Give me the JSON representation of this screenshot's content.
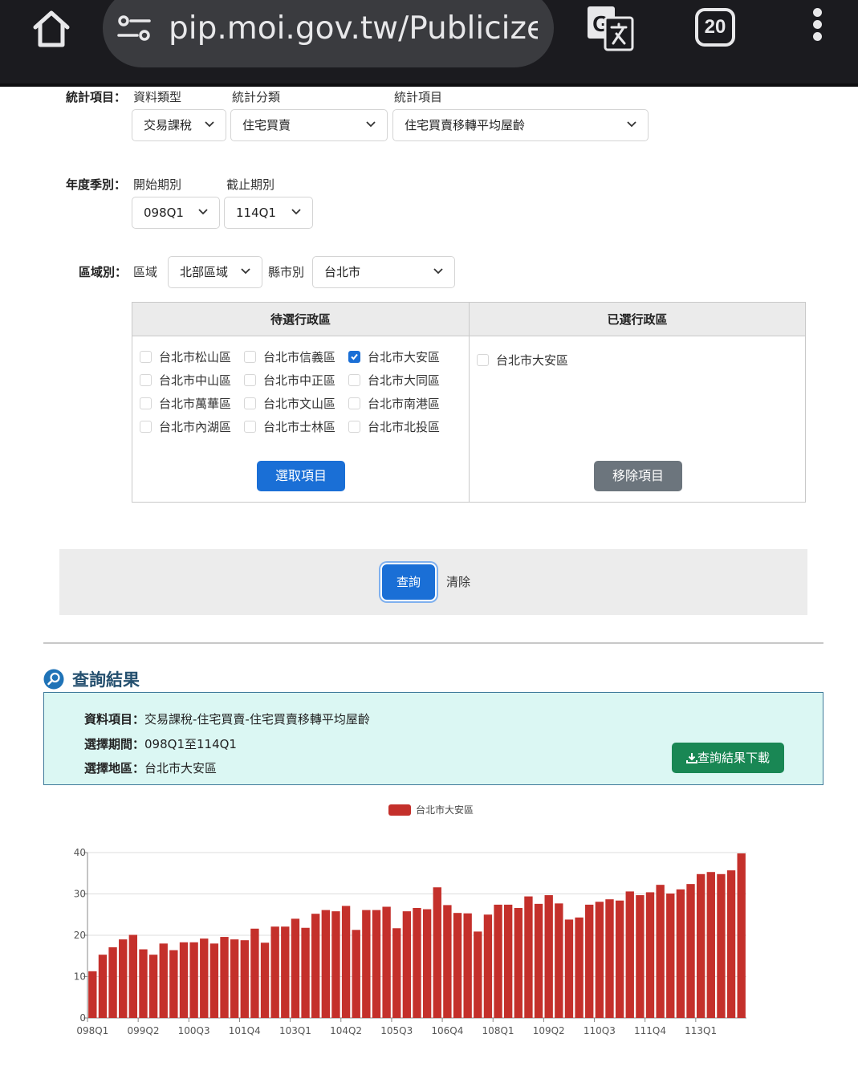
{
  "browser": {
    "url": "pip.moi.gov.tw/Publicize",
    "tab_count": "20"
  },
  "form": {
    "stat_item": {
      "label": "統計項目：",
      "type_label": "資料類型",
      "type_value": "交易課稅",
      "category_label": "統計分類",
      "category_value": "住宅買賣",
      "item_label": "統計項目",
      "item_value": "住宅買賣移轉平均屋齡"
    },
    "period": {
      "label": "年度季別：",
      "start_label": "開始期別",
      "start_value": "098Q1",
      "end_label": "截止期別",
      "end_value": "114Q1"
    },
    "region": {
      "label": "區域別：",
      "area_label": "區域",
      "area_value": "北部區域",
      "city_label": "縣市別",
      "city_value": "台北市"
    }
  },
  "districts": {
    "pending_title": "待選行政區",
    "selected_title": "已選行政區",
    "pending": [
      {
        "name": "台北市松山區",
        "checked": false
      },
      {
        "name": "台北市信義區",
        "checked": false
      },
      {
        "name": "台北市大安區",
        "checked": true
      },
      {
        "name": "台北市中山區",
        "checked": false
      },
      {
        "name": "台北市中正區",
        "checked": false
      },
      {
        "name": "台北市大同區",
        "checked": false
      },
      {
        "name": "台北市萬華區",
        "checked": false
      },
      {
        "name": "台北市文山區",
        "checked": false
      },
      {
        "name": "台北市南港區",
        "checked": false
      },
      {
        "name": "台北市內湖區",
        "checked": false
      },
      {
        "name": "台北市士林區",
        "checked": false
      },
      {
        "name": "台北市北投區",
        "checked": false
      }
    ],
    "selected": [
      {
        "name": "台北市大安區",
        "checked": false
      }
    ],
    "select_button": "選取項目",
    "remove_button": "移除項目"
  },
  "actions": {
    "query_button": "查詢",
    "clear_link": "清除"
  },
  "results": {
    "title": "查詢結果",
    "data_item_label": "資料項目：",
    "data_item_value": "交易課稅-住宅買賣-住宅買賣移轉平均屋齡",
    "period_label": "選擇期間：",
    "period_value": "098Q1至114Q1",
    "region_label": "選擇地區：",
    "region_value": "台北市大安區",
    "download_button": "查詢結果下載"
  },
  "colors": {
    "primary": "#1a6fd6",
    "success": "#198754",
    "bar": "#c4302b",
    "results_bg": "#dbf7f3",
    "title": "#25506f"
  },
  "chart_data": {
    "type": "bar",
    "legend": "台北市大安區",
    "legend_position": "top-center",
    "grid": true,
    "ylim": [
      0,
      40
    ],
    "yticks": [
      "0",
      "10",
      "20",
      "30",
      "40"
    ],
    "xtick_labels": [
      "098Q1",
      "099Q2",
      "100Q3",
      "101Q4",
      "103Q1",
      "104Q2",
      "105Q3",
      "106Q4",
      "108Q1",
      "109Q2",
      "110Q3",
      "111Q4",
      "113Q1"
    ],
    "categories": [
      "098Q1",
      "098Q2",
      "098Q3",
      "098Q4",
      "099Q1",
      "099Q2",
      "099Q3",
      "099Q4",
      "100Q1",
      "100Q2",
      "100Q3",
      "100Q4",
      "101Q1",
      "101Q2",
      "101Q3",
      "101Q4",
      "102Q1",
      "102Q2",
      "102Q3",
      "102Q4",
      "103Q1",
      "103Q2",
      "103Q3",
      "103Q4",
      "104Q1",
      "104Q2",
      "104Q3",
      "104Q4",
      "105Q1",
      "105Q2",
      "105Q3",
      "105Q4",
      "106Q1",
      "106Q2",
      "106Q3",
      "106Q4",
      "107Q1",
      "107Q2",
      "107Q3",
      "107Q4",
      "108Q1",
      "108Q2",
      "108Q3",
      "108Q4",
      "109Q1",
      "109Q2",
      "109Q3",
      "109Q4",
      "110Q1",
      "110Q2",
      "110Q3",
      "110Q4",
      "111Q1",
      "111Q2",
      "111Q3",
      "111Q4",
      "112Q1",
      "112Q2",
      "112Q3",
      "112Q4",
      "113Q1",
      "113Q2",
      "113Q3",
      "113Q4",
      "114Q1"
    ],
    "series": [
      {
        "name": "台北市大安區",
        "values": [
          11.3,
          15.3,
          17.1,
          19.0,
          20.1,
          16.6,
          15.3,
          18.0,
          16.4,
          18.3,
          18.3,
          19.2,
          18.0,
          19.6,
          19.0,
          18.8,
          21.6,
          18.2,
          22.1,
          22.1,
          24.0,
          21.8,
          25.2,
          26.1,
          25.8,
          27.1,
          21.3,
          26.1,
          26.1,
          26.9,
          21.7,
          25.8,
          26.6,
          26.3,
          31.6,
          27.3,
          25.4,
          25.3,
          20.9,
          25.0,
          27.4,
          27.4,
          26.6,
          29.4,
          27.6,
          29.7,
          27.7,
          23.8,
          24.3,
          27.4,
          28.1,
          28.7,
          28.4,
          30.6,
          29.7,
          30.4,
          32.2,
          30.1,
          31.1,
          32.4,
          34.8,
          35.3,
          34.8,
          35.7,
          39.8
        ]
      }
    ]
  }
}
